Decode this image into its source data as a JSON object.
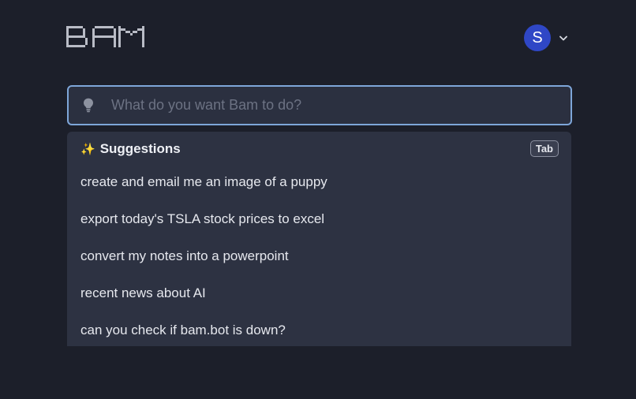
{
  "app": {
    "logo_text": "BAM"
  },
  "account": {
    "avatar_initial": "S",
    "avatar_color": "#2f47c6"
  },
  "search": {
    "placeholder": "What do you want Bam to do?",
    "value": "",
    "icon": "lightbulb-icon",
    "border_color": "#7ea6d9"
  },
  "suggestions": {
    "icon": "sparkles-icon",
    "title": "Suggestions",
    "shortcut": "Tab",
    "items": [
      {
        "label": "create and email me an image of a puppy"
      },
      {
        "label": "export today's TSLA stock prices to excel"
      },
      {
        "label": "convert my notes into a powerpoint"
      },
      {
        "label": "recent news about AI"
      },
      {
        "label": "can you check if bam.bot is down?"
      }
    ]
  },
  "colors": {
    "background": "#1c1f2a",
    "panel": "#2d3242",
    "text": "#e6e8ee"
  }
}
